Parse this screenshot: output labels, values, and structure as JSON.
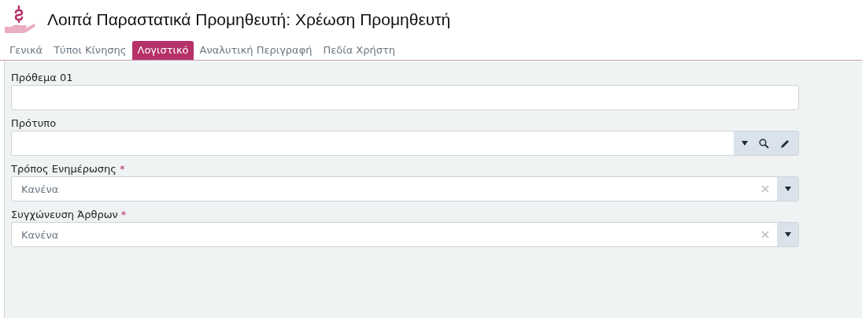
{
  "title": "Λοιπά Παραστατικά Προμηθευτή: Χρέωση Προμηθευτή",
  "tabs": [
    {
      "label": "Γενικά",
      "selected": false
    },
    {
      "label": "Τύποι Κίνησης",
      "selected": false
    },
    {
      "label": "Λογιστικό",
      "selected": true
    },
    {
      "label": "Αναλυτική Περιγραφή",
      "selected": false
    },
    {
      "label": "Πεδία Χρήστη",
      "selected": false
    }
  ],
  "fields": [
    {
      "kind": "text",
      "label": "Πρόθεμα 01"
    },
    {
      "kind": "lookup",
      "label": "Πρότυπο"
    },
    {
      "kind": "select",
      "label": "Τρόπος Ενημέρωσης",
      "required_mark": "*",
      "value": "Κανένα"
    },
    {
      "kind": "select",
      "label": "Συγχώνευση Άρθρων",
      "required_mark": "*",
      "value": "Κανένα"
    }
  ]
}
